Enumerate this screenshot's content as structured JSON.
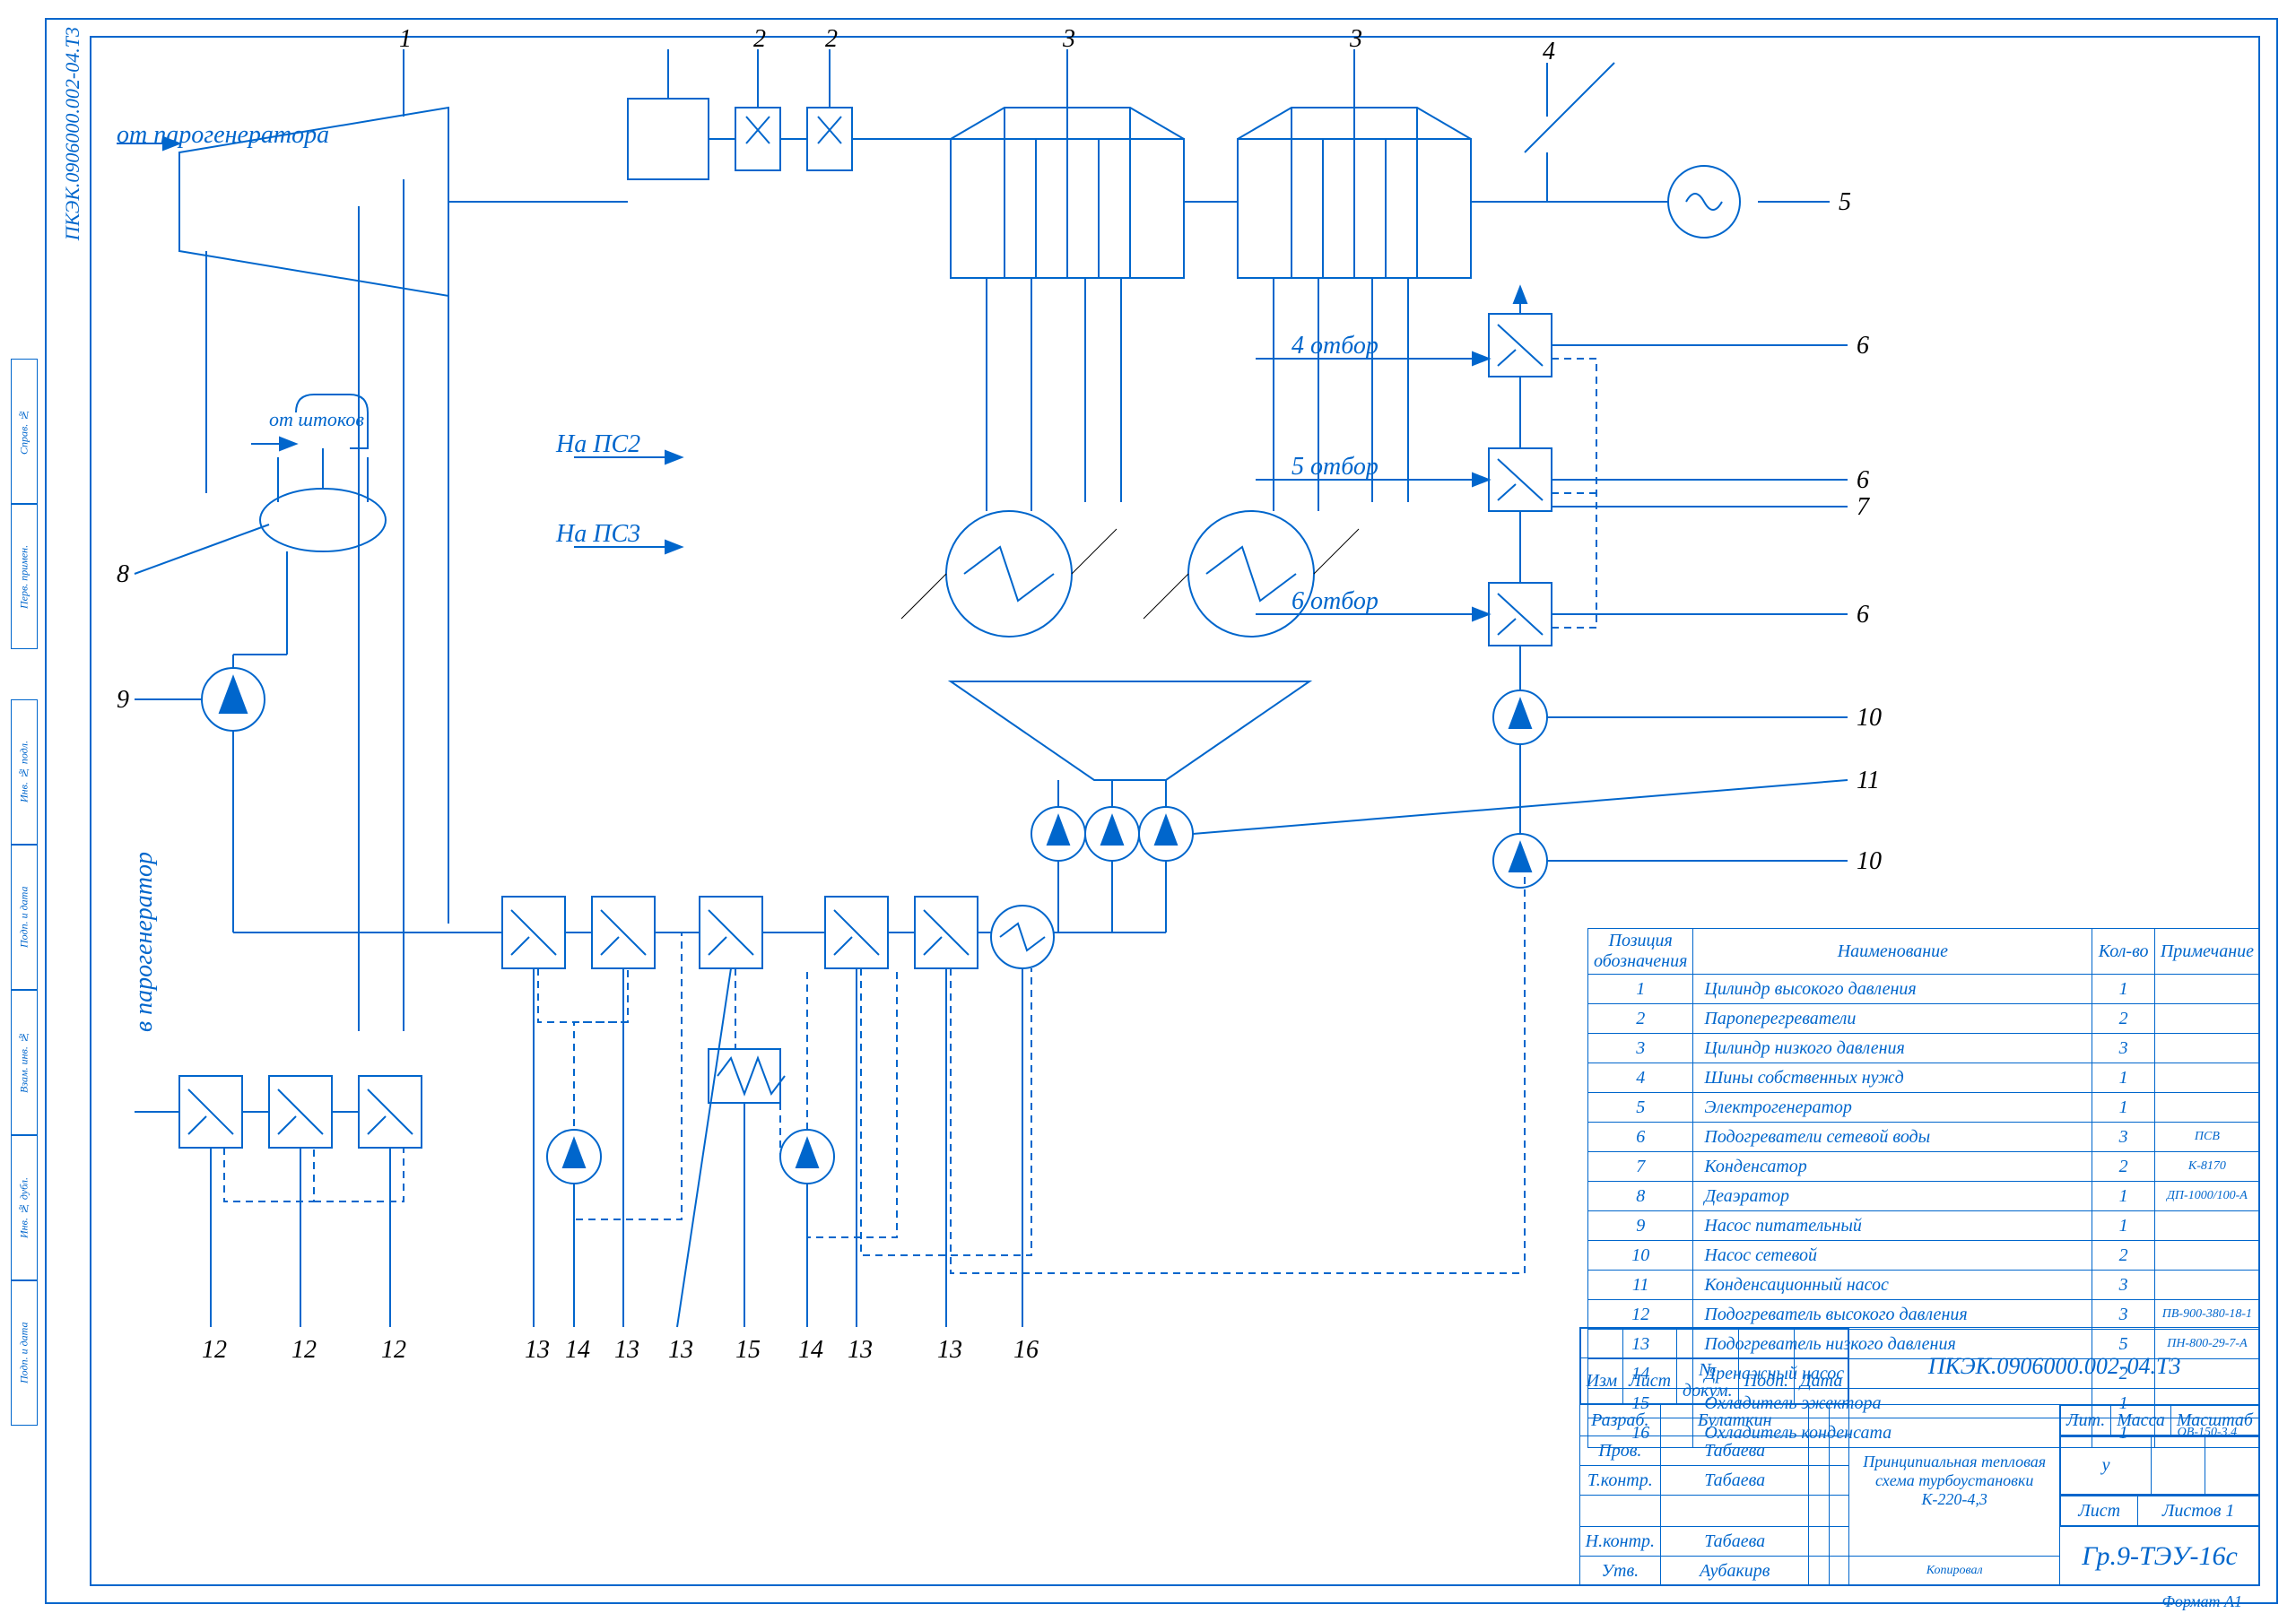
{
  "doc_code": "ПКЭК.0906000.002-04.Т3",
  "doc_title": "Принципиальная тепловая схема турбоустановки К-220-4,3",
  "group": "Гр.9-ТЭУ-16с",
  "format": "Формат     A1",
  "labels": {
    "from_pg": "от парогенератора",
    "to_pg": "в парогенератор",
    "shtokov": "от штоков",
    "ps2": "На ПС2",
    "ps3": "На ПС3",
    "otb4": "4 отбор",
    "otb5": "5 отбор",
    "otb6": "6 отбор"
  },
  "callouts": [
    "1",
    "2",
    "2",
    "3",
    "3",
    "4",
    "5",
    "6",
    "6",
    "7",
    "6",
    "8",
    "9",
    "10",
    "11",
    "10",
    "12",
    "12",
    "12",
    "13",
    "14",
    "13",
    "13",
    "15",
    "14",
    "13",
    "13",
    "16"
  ],
  "parts_header": {
    "pos": "Позиция обозначения",
    "name": "Наименование",
    "qty": "Кол-во",
    "note": "Примечание"
  },
  "parts": [
    {
      "n": "1",
      "name": "Цилиндр высокого давления",
      "q": "1",
      "r": ""
    },
    {
      "n": "2",
      "name": "Пароперегреватели",
      "q": "2",
      "r": ""
    },
    {
      "n": "3",
      "name": "Цилиндр низкого давления",
      "q": "3",
      "r": ""
    },
    {
      "n": "4",
      "name": "Шины собственных нужд",
      "q": "1",
      "r": ""
    },
    {
      "n": "5",
      "name": "Электрогенератор",
      "q": "1",
      "r": ""
    },
    {
      "n": "6",
      "name": "Подогреватели сетевой воды",
      "q": "3",
      "r": "ПСВ"
    },
    {
      "n": "7",
      "name": "Конденсатор",
      "q": "2",
      "r": "К-8170"
    },
    {
      "n": "8",
      "name": "Деаэратор",
      "q": "1",
      "r": "ДП-1000/100-А"
    },
    {
      "n": "9",
      "name": "Насос питательный",
      "q": "1",
      "r": ""
    },
    {
      "n": "10",
      "name": "Насос сетевой",
      "q": "2",
      "r": ""
    },
    {
      "n": "11",
      "name": "Конденсационный насос",
      "q": "3",
      "r": ""
    },
    {
      "n": "12",
      "name": "Подогреватель высокого давления",
      "q": "3",
      "r": "ПВ-900-380-18-1"
    },
    {
      "n": "13",
      "name": "Подогреватель низкого давления",
      "q": "5",
      "r": "ПН-800-29-7-А"
    },
    {
      "n": "14",
      "name": "Дренажный насос",
      "q": "2",
      "r": ""
    },
    {
      "n": "15",
      "name": "Охладитель эжектора",
      "q": "1",
      "r": ""
    },
    {
      "n": "16",
      "name": "Охладитель конденсата",
      "q": "1",
      "r": "ОВ-150-3,4"
    }
  ],
  "stamp": {
    "row_hdr": [
      "Изм",
      "Лист",
      "№ докум.",
      "Подп.",
      "Дата"
    ],
    "rows": [
      [
        "Разраб.",
        "Булаткин",
        "",
        ""
      ],
      [
        "Пров.",
        "Табаева",
        "",
        ""
      ],
      [
        "Т.контр.",
        "Табаева",
        "",
        ""
      ],
      [
        "Н.контр.",
        "Табаева",
        "",
        ""
      ],
      [
        "Утв.",
        "Аубакирв",
        "",
        ""
      ]
    ],
    "lit": "Лит.",
    "mass": "Масса",
    "scale": "Масштаб",
    "u": "у",
    "sheet": "Лист",
    "sheets": "Листов   1",
    "kop": "Копировал"
  },
  "side": [
    "Инв. № подл.",
    "Подп. и дата",
    "Взам. инв. №",
    "Инв. № дубл.",
    "Подп. и дата",
    "Справ. №",
    "Перв. примен."
  ]
}
